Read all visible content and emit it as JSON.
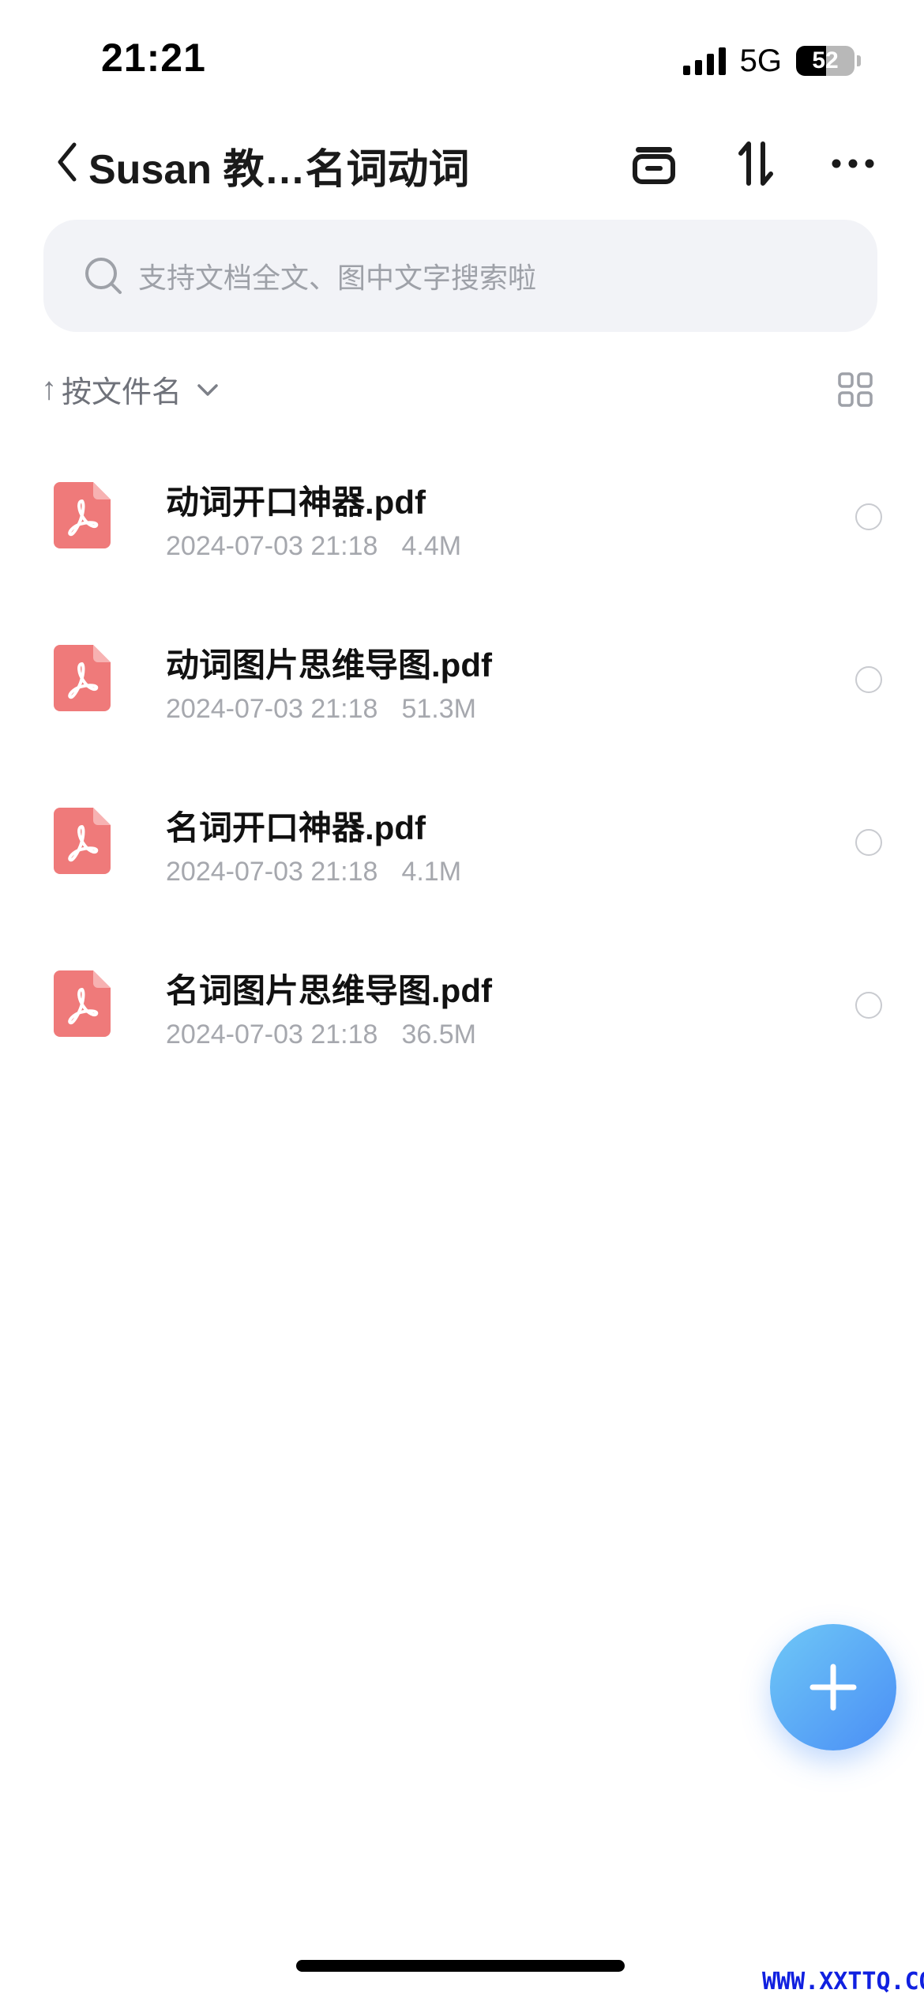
{
  "status_bar": {
    "time": "21:21",
    "network": "5G",
    "battery_percent": 52,
    "battery_label": "52"
  },
  "nav": {
    "title": "Susan 教…名词动词",
    "back_icon": "chevron-left-icon",
    "actions": [
      "archive-icon",
      "sort-arrows-icon",
      "more-icon"
    ]
  },
  "search": {
    "placeholder": "支持文档全文、图中文字搜索啦"
  },
  "sort": {
    "arrow": "↑",
    "label": "按文件名"
  },
  "files": [
    {
      "name": "动词开口神器.pdf",
      "date": "2024-07-03 21:18",
      "size": "4.4M"
    },
    {
      "name": "动词图片思维导图.pdf",
      "date": "2024-07-03 21:18",
      "size": "51.3M"
    },
    {
      "name": "名词开口神器.pdf",
      "date": "2024-07-03 21:18",
      "size": "4.1M"
    },
    {
      "name": "名词图片思维导图.pdf",
      "date": "2024-07-03 21:18",
      "size": "36.5M"
    }
  ],
  "colors": {
    "pdf_icon": "#ef7a7a",
    "accent_gradient_start": "#6fc8f7",
    "accent_gradient_end": "#4a8ef5"
  },
  "watermark": "WWW.XXTTQ.COM"
}
